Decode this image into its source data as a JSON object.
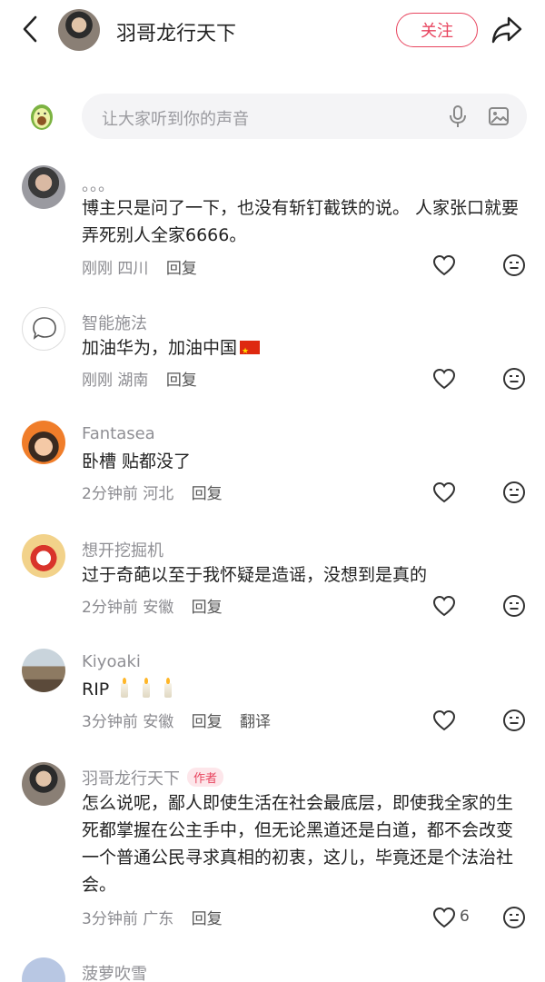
{
  "header": {
    "title": "羽哥龙行天下",
    "follow_label": "关注"
  },
  "input": {
    "placeholder": "让大家听到你的声音"
  },
  "comments": [
    {
      "name": "。。。",
      "text": "博主只是问了一下，也没有斩钉截铁的说。 人家张口就要弄死别人全家6666。",
      "time": "刚刚",
      "location": "四川",
      "reply": "回复"
    },
    {
      "name": "智能施法",
      "text": "加油华为，加油中国",
      "time": "刚刚",
      "location": "湖南",
      "reply": "回复"
    },
    {
      "name": "Fantasea",
      "text": "卧槽 贴都没了",
      "time": "2分钟前",
      "location": "河北",
      "reply": "回复"
    },
    {
      "name": "想开挖掘机",
      "text": "过于奇葩以至于我怀疑是造谣，没想到是真的",
      "time": "2分钟前",
      "location": "安徽",
      "reply": "回复"
    },
    {
      "name": "Kiyoaki",
      "text": "RIP",
      "time": "3分钟前",
      "location": "安徽",
      "reply": "回复",
      "translate": "翻译"
    },
    {
      "name": "羽哥龙行天下",
      "badge": "作者",
      "text": "怎么说呢，鄙人即使生活在社会最底层，即使我全家的生死都掌握在公主手中，但无论黑道还是白道，都不会改变一个普通公民寻求真相的初衷，这儿，毕竟还是个法治社会。",
      "time": "3分钟前",
      "location": "广东",
      "reply": "回复",
      "likes": "6"
    },
    {
      "name": "菠萝吹雪"
    }
  ],
  "icons": {
    "back": "chevron-left-icon",
    "share": "share-arrow-icon",
    "mic": "microphone-icon",
    "image": "image-icon",
    "like": "heart-outline-icon",
    "emoji": "emoji-face-icon"
  },
  "colors": {
    "accent": "#e8455f",
    "meta": "#8a8a8f",
    "input_bg": "#f4f4f6"
  }
}
